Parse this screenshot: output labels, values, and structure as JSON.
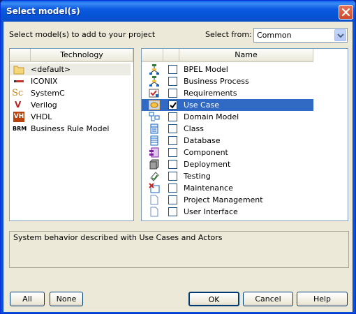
{
  "window": {
    "title": "Select model(s)"
  },
  "instruction": "Select model(s) to add to your project",
  "select_from": {
    "label": "Select from:",
    "value": "Common"
  },
  "technology": {
    "header": "Technology",
    "items": [
      {
        "label": "<default>",
        "icon": "folder-icon",
        "selected": true
      },
      {
        "label": "ICONIX",
        "icon": "iconix-icon"
      },
      {
        "label": "SystemC",
        "icon": "systemc-icon",
        "icon_text": "Sc"
      },
      {
        "label": "Verilog",
        "icon": "verilog-icon",
        "icon_text": "V"
      },
      {
        "label": "VHDL",
        "icon": "vhdl-icon",
        "icon_text": "VH"
      },
      {
        "label": "Business Rule Model",
        "icon": "brm-icon",
        "icon_text": "BRM"
      }
    ]
  },
  "models": {
    "header": "Name",
    "items": [
      {
        "label": "BPEL Model",
        "checked": false,
        "icon": "bpel-icon"
      },
      {
        "label": "Business Process",
        "checked": false,
        "icon": "business-process-icon"
      },
      {
        "label": "Requirements",
        "checked": false,
        "icon": "requirements-icon"
      },
      {
        "label": "Use Case",
        "checked": true,
        "selected": true,
        "icon": "use-case-icon"
      },
      {
        "label": "Domain Model",
        "checked": false,
        "icon": "domain-model-icon"
      },
      {
        "label": "Class",
        "checked": false,
        "icon": "class-icon"
      },
      {
        "label": "Database",
        "checked": false,
        "icon": "database-icon"
      },
      {
        "label": "Component",
        "checked": false,
        "icon": "component-icon"
      },
      {
        "label": "Deployment",
        "checked": false,
        "icon": "deployment-icon"
      },
      {
        "label": "Testing",
        "checked": false,
        "icon": "testing-icon"
      },
      {
        "label": "Maintenance",
        "checked": false,
        "icon": "maintenance-icon"
      },
      {
        "label": "Project Management",
        "checked": false,
        "icon": "project-management-icon"
      },
      {
        "label": "User Interface",
        "checked": false,
        "icon": "user-interface-icon"
      }
    ]
  },
  "description": "System behavior described with Use Cases and Actors",
  "buttons": {
    "all": "All",
    "none": "None",
    "ok": "OK",
    "cancel": "Cancel",
    "help": "Help"
  },
  "colors": {
    "title_bar": "#0a5fe8",
    "selection": "#316ac5",
    "dialog_bg": "#ece9d8"
  }
}
